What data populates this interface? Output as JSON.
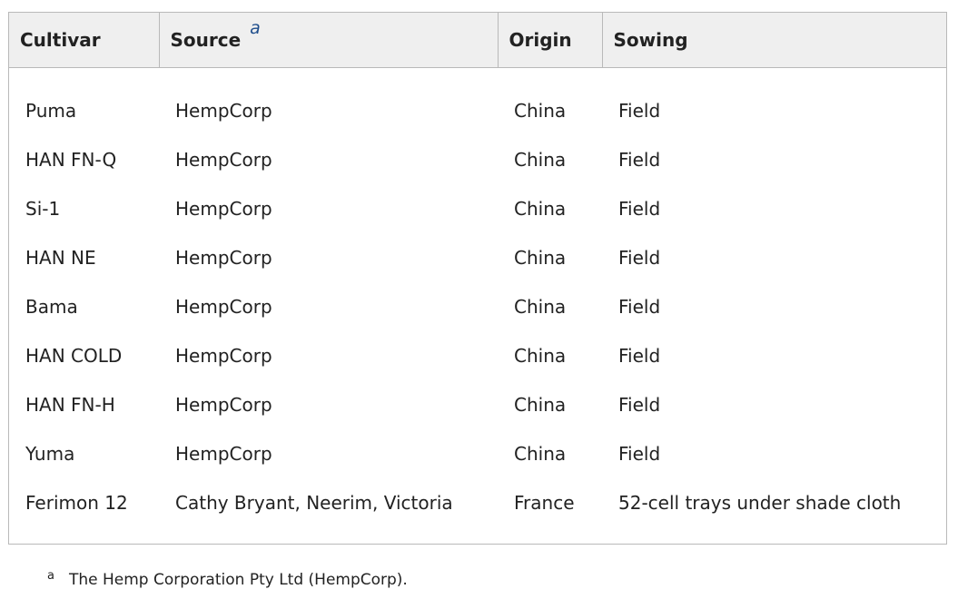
{
  "table": {
    "headers": [
      "Cultivar",
      "Source",
      "Origin",
      "Sowing"
    ],
    "source_header_footnote_mark": "a",
    "rows": [
      [
        "Puma",
        "HempCorp",
        "China",
        "Field"
      ],
      [
        "HAN FN-Q",
        "HempCorp",
        "China",
        "Field"
      ],
      [
        "Si-1",
        "HempCorp",
        "China",
        "Field"
      ],
      [
        "HAN NE",
        "HempCorp",
        "China",
        "Field"
      ],
      [
        "Bama",
        "HempCorp",
        "China",
        "Field"
      ],
      [
        "HAN COLD",
        "HempCorp",
        "China",
        "Field"
      ],
      [
        "HAN FN-H",
        "HempCorp",
        "China",
        "Field"
      ],
      [
        "Yuma",
        "HempCorp",
        "China",
        "Field"
      ],
      [
        "Ferimon 12",
        "Cathy Bryant, Neerim, Victoria",
        "France",
        "52-cell trays under shade cloth"
      ]
    ]
  },
  "footnote": {
    "mark": "a",
    "text": "The Hemp Corporation Pty Ltd (HempCorp)."
  }
}
